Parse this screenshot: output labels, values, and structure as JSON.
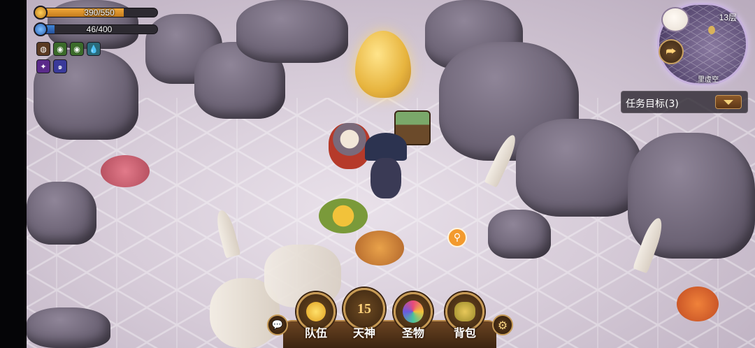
{
  "hud": {
    "hp": {
      "text": "390/550",
      "current": 390,
      "max": 550,
      "color": "#f2a93a"
    },
    "mp": {
      "text": "46/400",
      "current": 46,
      "max": 400,
      "color": "#3f86d8"
    },
    "buffs": [
      {
        "icon": "meat-buff-icon",
        "color": "#5a3a22"
      },
      {
        "icon": "green-eye-buff-icon",
        "color": "#3b6b2a"
      },
      {
        "icon": "green-eye-buff-icon",
        "color": "#3b6b2a"
      },
      {
        "icon": "water-drop-buff-icon",
        "color": "#2a6b7a"
      },
      {
        "icon": "purple-magic-buff-icon",
        "color": "#5a2a8a"
      },
      {
        "icon": "swirl-buff-icon",
        "color": "#3a3a9a"
      }
    ]
  },
  "minimap": {
    "floor": "13层",
    "area": "里虚空"
  },
  "quest": {
    "label": "任务目标(3)"
  },
  "menu": {
    "team": "队伍",
    "god": "天神",
    "god_level": "15",
    "relic": "圣物",
    "bag": "背包"
  }
}
